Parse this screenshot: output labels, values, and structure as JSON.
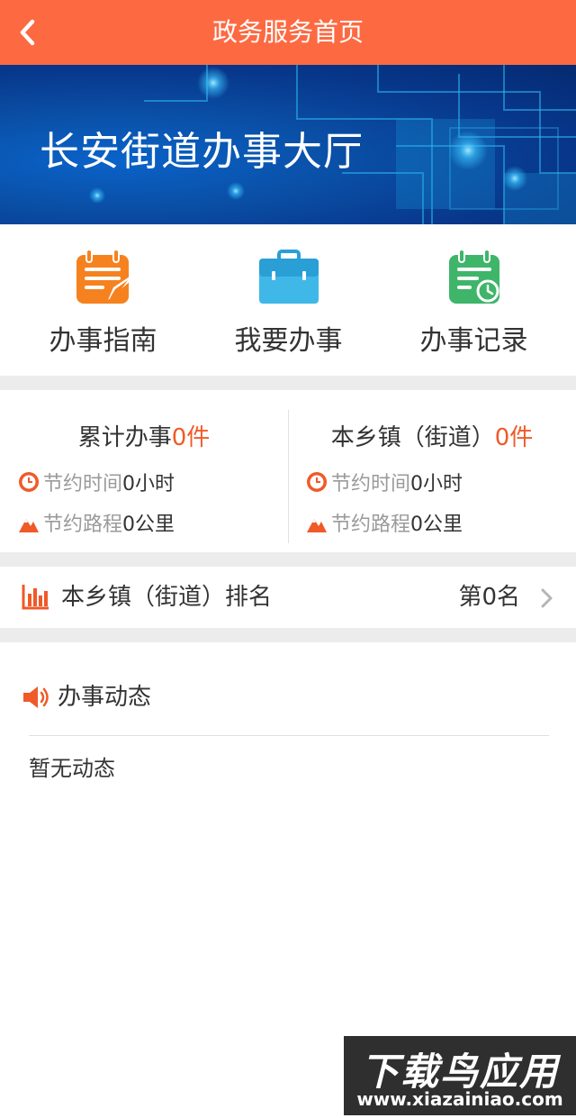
{
  "header": {
    "title": "政务服务首页"
  },
  "banner": {
    "title": "长安街道办事大厅"
  },
  "quick_actions": [
    {
      "label": "办事指南",
      "icon": "guide-notepad-icon",
      "color": "#f5821f"
    },
    {
      "label": "我要办事",
      "icon": "briefcase-icon",
      "color": "#3fb8e8"
    },
    {
      "label": "办事记录",
      "icon": "record-notepad-clock-icon",
      "color": "#3fb56a"
    }
  ],
  "stats": {
    "left": {
      "title_prefix": "累计办事",
      "title_count": "0件",
      "time_label": "节约时间",
      "time_value": "0小时",
      "route_label": "节约路程",
      "route_value": "0公里"
    },
    "right": {
      "title_prefix": "本乡镇（街道）",
      "title_count": "0件",
      "time_label": "节约时间",
      "time_value": "0小时",
      "route_label": "节约路程",
      "route_value": "0公里"
    }
  },
  "ranking": {
    "label": "本乡镇（街道）排名",
    "value": "第0名"
  },
  "news": {
    "title": "办事动态",
    "empty_text": "暂无动态"
  },
  "watermark": {
    "main": "下载鸟应用",
    "sub": "www.xiazainiao.com"
  },
  "colors": {
    "header": "#fd6a42",
    "accent": "#f05a28",
    "page_gap": "#ececec"
  }
}
